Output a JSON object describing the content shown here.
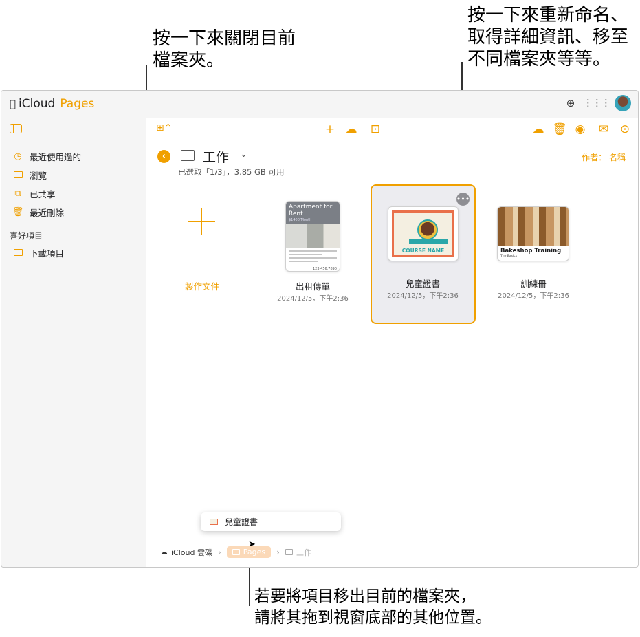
{
  "callouts": {
    "close_folder": [
      "按一下來關閉目前",
      "檔案夾。"
    ],
    "more_actions": [
      "按一下來重新命名、",
      "取得詳細資訊、移至",
      "不同檔案夾等等。"
    ],
    "drag_out": [
      "若要將項目移出目前的檔案夾，",
      "請將其拖到視窗底部的其他位置。"
    ]
  },
  "app": {
    "brand_icloud": "iCloud",
    "brand_pages": "Pages"
  },
  "sidebar": {
    "items": [
      {
        "label": "最近使用過的",
        "icon": "clock-icon"
      },
      {
        "label": "瀏覽",
        "icon": "folder-icon"
      },
      {
        "label": "已共享",
        "icon": "shared-folder-icon"
      },
      {
        "label": "最近刪除",
        "icon": "trash-icon"
      }
    ],
    "favorites_label": "喜好項目",
    "favorites": [
      {
        "label": "下載項目",
        "icon": "folder-icon"
      }
    ]
  },
  "folder": {
    "title": "工作",
    "info": "已選取「1/3」，3.85 GB 可用",
    "sort": "作者： 名稱"
  },
  "new_doc": {
    "label": "製作文件"
  },
  "documents": [
    {
      "name": "出租傳單",
      "date": "2024/12/5，下午2:36",
      "thumb_title": "Apartment for Rent",
      "thumb_sub": "$1400/Month",
      "thumb_phone": "123.456.7890"
    },
    {
      "name": "兒童證書",
      "date": "2024/12/5，下午2:36",
      "thumb_course": "COURSE NAME"
    },
    {
      "name": "訓練冊",
      "date": "2024/12/5，下午2:36",
      "thumb_title": "Bakeshop Training",
      "thumb_sub": "The Basics"
    }
  ],
  "drag_item": {
    "label": "兒童證書"
  },
  "breadcrumb": {
    "cloud": "iCloud 雲碟",
    "pages": "Pages",
    "work": "工作"
  },
  "colors": {
    "accent": "#f0a000",
    "selection_bg": "#ececf0"
  }
}
